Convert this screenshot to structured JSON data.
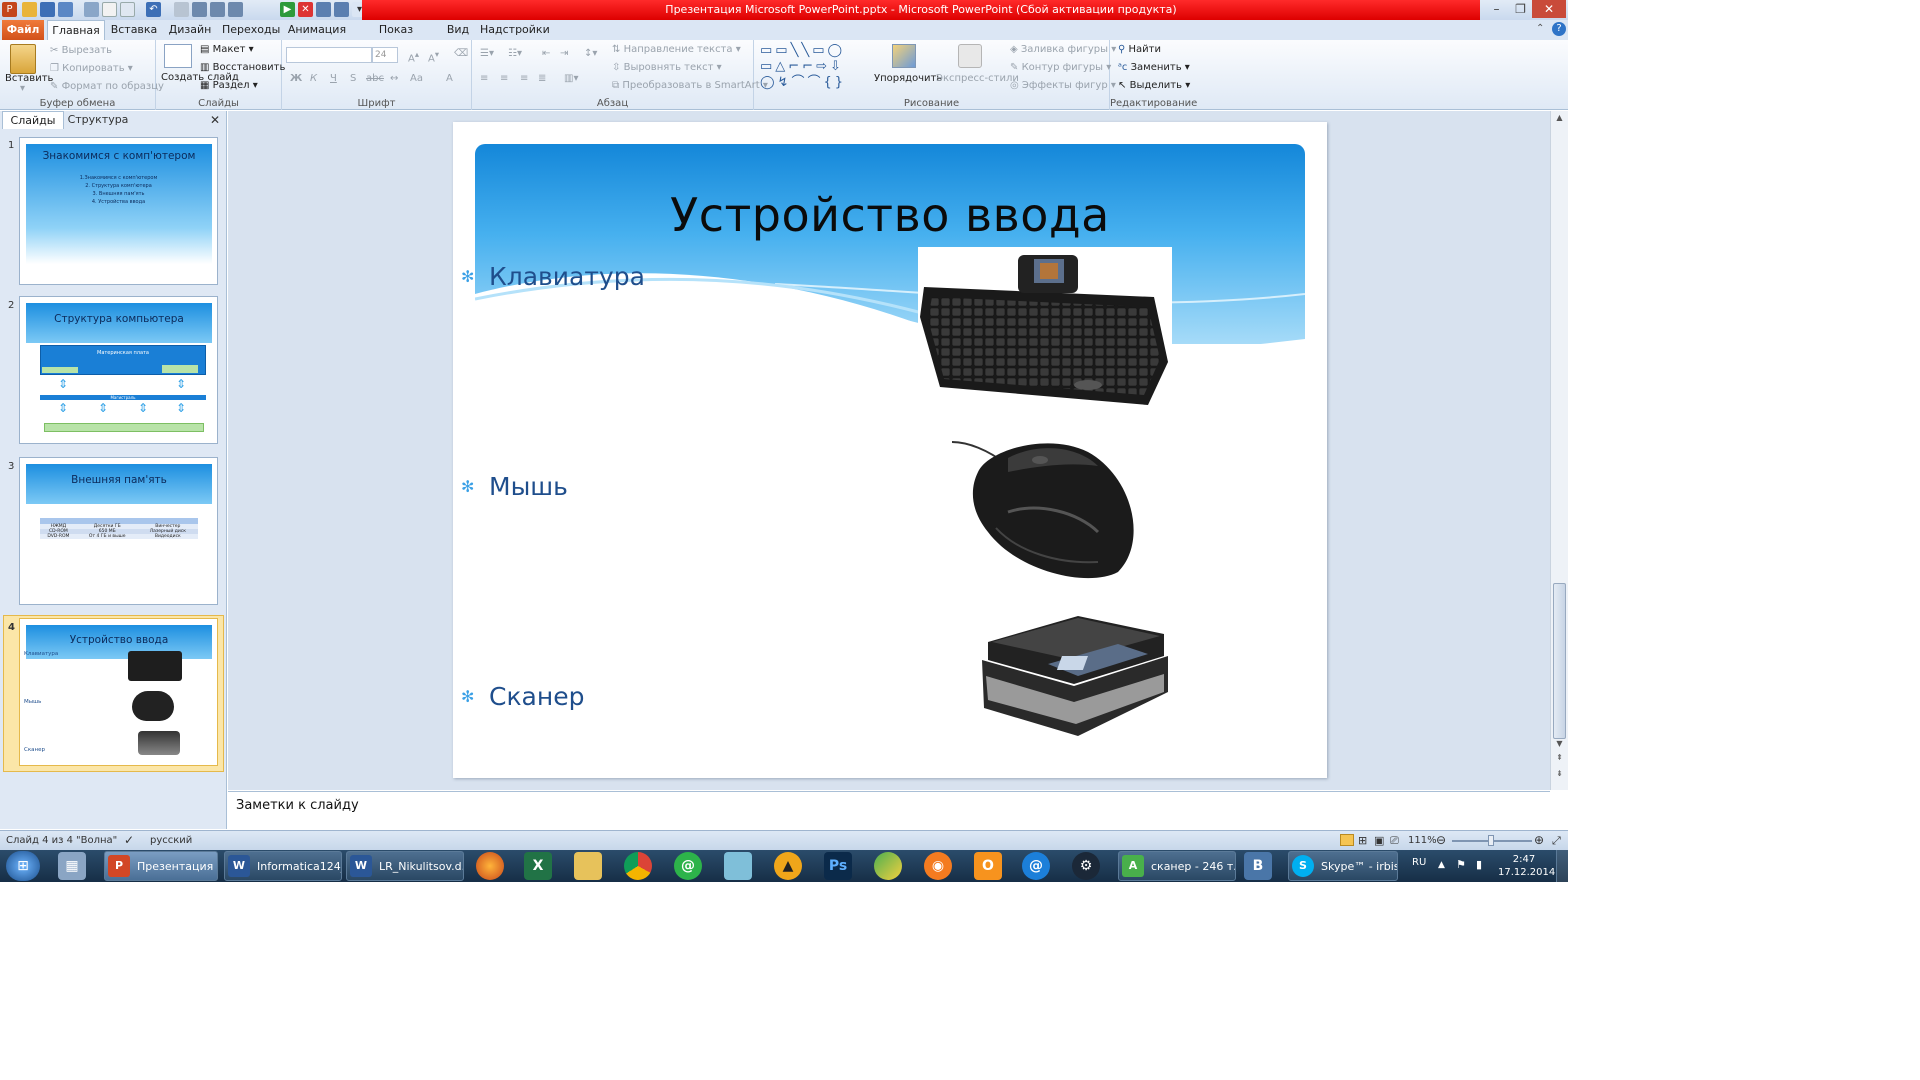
{
  "titlebar": {
    "title": "Презентация Microsoft PowerPoint.pptx  -  Microsoft PowerPoint (Сбой активации продукта)"
  },
  "ribbon_tabs": [
    "Файл",
    "Главная",
    "Вставка",
    "Дизайн",
    "Переходы",
    "Анимация",
    "Показ слайдов",
    "Вид",
    "Надстройки"
  ],
  "clipboard": {
    "paste": "Вставить",
    "cut": "Вырезать",
    "copy": "Копировать",
    "format_painter": "Формат по образцу",
    "label": "Буфер обмена"
  },
  "slides_group": {
    "new_slide": "Создать слайд",
    "layout": "Макет",
    "reset": "Восстановить",
    "section": "Раздел",
    "label": "Слайды"
  },
  "font_group": {
    "font_size": "24",
    "label": "Шрифт",
    "bold": "Ж",
    "italic": "К",
    "underline": "Ч",
    "strike": "S",
    "abc": "abc",
    "case": "Aa",
    "color": "A"
  },
  "paragraph_group": {
    "text_direction": "Направление текста",
    "align_text": "Выровнять текст",
    "smartart": "Преобразовать в SmartArt",
    "label": "Абзац"
  },
  "drawing_group": {
    "arrange": "Упорядочить",
    "quick_styles": "Экспресс-стили",
    "shape_fill": "Заливка фигуры",
    "shape_outline": "Контур фигуры",
    "shape_effects": "Эффекты фигур",
    "label": "Рисование"
  },
  "editing_group": {
    "find": "Найти",
    "replace": "Заменить",
    "select": "Выделить",
    "label": "Редактирование"
  },
  "left_pane": {
    "tab_slides": "Слайды",
    "tab_outline": "Структура",
    "thumbnails": [
      {
        "num": "1",
        "title": "Знакомимся с комп'ютером",
        "lines": [
          "1.Знакомимся с комп'ютером",
          "2. Структура комп'ютера",
          "3. Внешняя пам'ять",
          "4. Устройства ввода"
        ]
      },
      {
        "num": "2",
        "title": "Структура компьютера",
        "motherboard": "Материнская плата",
        "bus": "Магистраль"
      },
      {
        "num": "3",
        "title": "Внешняя пам'ять",
        "table": [
          [
            "НЖМД",
            "Десятки ГБ",
            "Винчестер"
          ],
          [
            "CD-ROM",
            "650 МБ",
            "Лазерный диск"
          ],
          [
            "DVD-ROM",
            "От 4 ГБ и выше",
            "Видеодиск"
          ]
        ]
      },
      {
        "num": "4",
        "title": "Устройство ввода",
        "items": [
          "Клавиатура",
          "Мышь",
          "Сканер"
        ]
      }
    ]
  },
  "slide": {
    "title": "Устройство ввода",
    "bullets": [
      "Клавиатура",
      "Мышь",
      "Сканер"
    ]
  },
  "notes": {
    "placeholder": "Заметки к слайду"
  },
  "statusbar": {
    "slide_info": "Слайд 4 из 4",
    "theme": "\"Волна\"",
    "language": "русский",
    "zoom": "111%"
  },
  "taskbar": {
    "tasks": [
      "Презентация ...",
      "Informatica124_...",
      "LR_Nikulitsov.d...",
      "сканер - 246 т...",
      "Skype™ - irbis7..."
    ],
    "lang": "RU",
    "time": "2:47",
    "date": "17.12.2014"
  },
  "colors": {
    "title_red": "#e00000",
    "ribbon_bg": "#dfe9f5",
    "slide_blue": "#1487d9",
    "bullet_text": "#1f4e8c"
  }
}
